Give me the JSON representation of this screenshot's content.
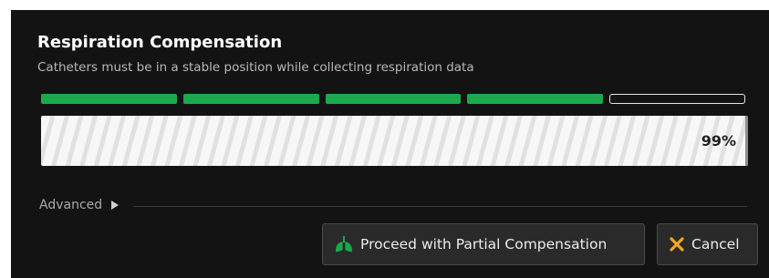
{
  "dialog": {
    "title": "Respiration Compensation",
    "subtitle": "Catheters must be in a stable position while collecting respiration data"
  },
  "stages": {
    "total": 5,
    "completed": 4,
    "filled_color": "#1ba94c"
  },
  "progress": {
    "value": 0.99,
    "label": "99%"
  },
  "advanced": {
    "label": "Advanced",
    "icon": "triangle-right-icon"
  },
  "buttons": {
    "proceed": {
      "label": "Proceed with Partial Compensation",
      "icon": "lungs-icon",
      "icon_color": "#1ba94c"
    },
    "cancel": {
      "label": "Cancel",
      "icon": "close-icon",
      "icon_color": "#f5a623"
    }
  },
  "colors": {
    "background": "#131313",
    "text": "#ffffff",
    "muted_text": "#b9b9b9"
  }
}
